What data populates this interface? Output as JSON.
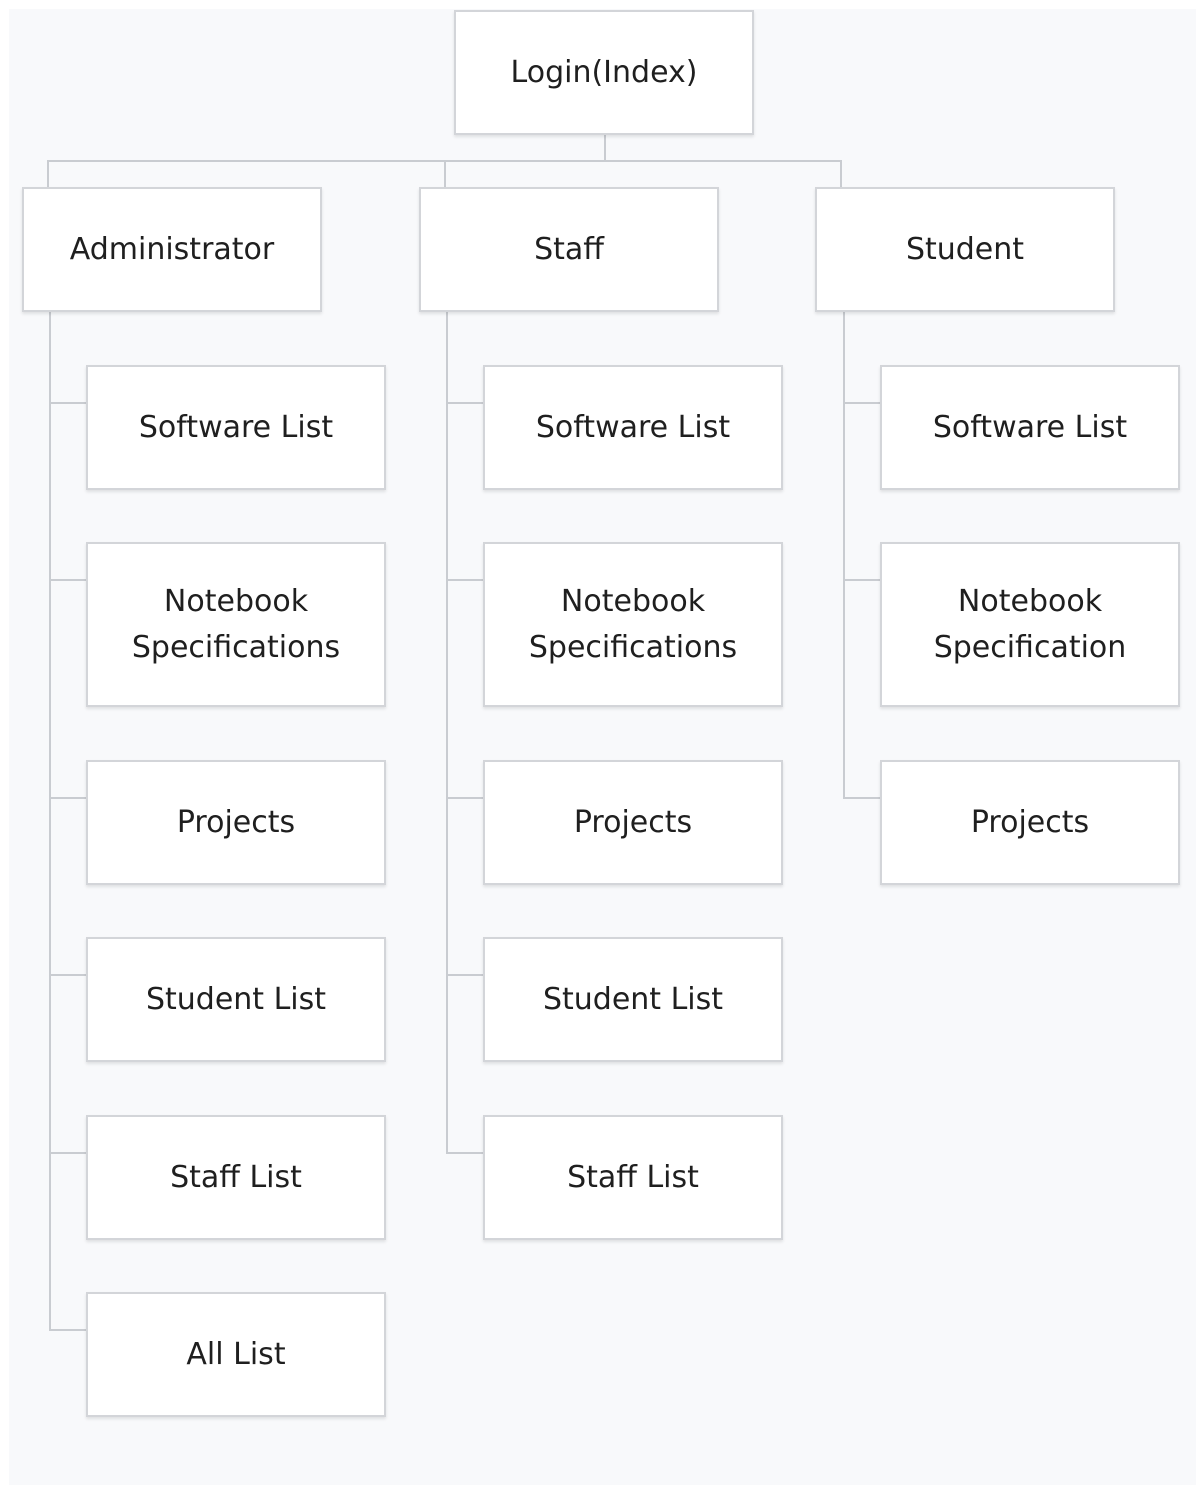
{
  "root": {
    "label": "Login(Index)"
  },
  "branches": [
    {
      "label": "Administrator",
      "children": [
        "Software List",
        "Notebook Specifications",
        "Projects",
        "Student List",
        "Staff List",
        "All List"
      ]
    },
    {
      "label": "Staff",
      "children": [
        "Software List",
        "Notebook Specifications",
        "Projects",
        "Student List",
        "Staff List"
      ]
    },
    {
      "label": "Student",
      "children": [
        "Software List",
        "Notebook Specification",
        "Projects"
      ]
    }
  ],
  "colors": {
    "canvas_background": "#f8f9fb",
    "node_fill": "#ffffff",
    "node_border": "#d3d5d9",
    "connector": "#c9ccd1",
    "text": "#1f1f1f"
  }
}
